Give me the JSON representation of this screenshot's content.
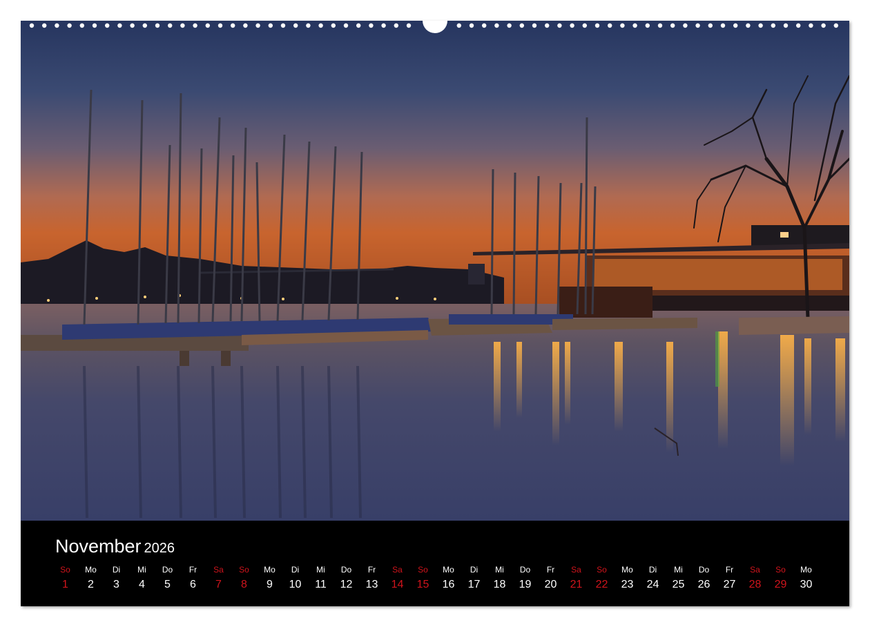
{
  "calendar": {
    "month": "November",
    "year": "2026",
    "days": [
      {
        "abbr": "So",
        "num": "1",
        "weekend": true
      },
      {
        "abbr": "Mo",
        "num": "2",
        "weekend": false
      },
      {
        "abbr": "Di",
        "num": "3",
        "weekend": false
      },
      {
        "abbr": "Mi",
        "num": "4",
        "weekend": false
      },
      {
        "abbr": "Do",
        "num": "5",
        "weekend": false
      },
      {
        "abbr": "Fr",
        "num": "6",
        "weekend": false
      },
      {
        "abbr": "Sa",
        "num": "7",
        "weekend": true
      },
      {
        "abbr": "So",
        "num": "8",
        "weekend": true
      },
      {
        "abbr": "Mo",
        "num": "9",
        "weekend": false
      },
      {
        "abbr": "Di",
        "num": "10",
        "weekend": false
      },
      {
        "abbr": "Mi",
        "num": "11",
        "weekend": false
      },
      {
        "abbr": "Do",
        "num": "12",
        "weekend": false
      },
      {
        "abbr": "Fr",
        "num": "13",
        "weekend": false
      },
      {
        "abbr": "Sa",
        "num": "14",
        "weekend": true
      },
      {
        "abbr": "So",
        "num": "15",
        "weekend": true
      },
      {
        "abbr": "Mo",
        "num": "16",
        "weekend": false
      },
      {
        "abbr": "Di",
        "num": "17",
        "weekend": false
      },
      {
        "abbr": "Mi",
        "num": "18",
        "weekend": false
      },
      {
        "abbr": "Do",
        "num": "19",
        "weekend": false
      },
      {
        "abbr": "Fr",
        "num": "20",
        "weekend": false
      },
      {
        "abbr": "Sa",
        "num": "21",
        "weekend": true
      },
      {
        "abbr": "So",
        "num": "22",
        "weekend": true
      },
      {
        "abbr": "Mo",
        "num": "23",
        "weekend": false
      },
      {
        "abbr": "Di",
        "num": "24",
        "weekend": false
      },
      {
        "abbr": "Mi",
        "num": "25",
        "weekend": false
      },
      {
        "abbr": "Do",
        "num": "26",
        "weekend": false
      },
      {
        "abbr": "Fr",
        "num": "27",
        "weekend": false
      },
      {
        "abbr": "Sa",
        "num": "28",
        "weekend": true
      },
      {
        "abbr": "So",
        "num": "29",
        "weekend": true
      },
      {
        "abbr": "Mo",
        "num": "30",
        "weekend": false
      }
    ]
  },
  "colors": {
    "weekend": "#d0141c",
    "weekday": "#ffffff",
    "bar_background": "#000000"
  }
}
